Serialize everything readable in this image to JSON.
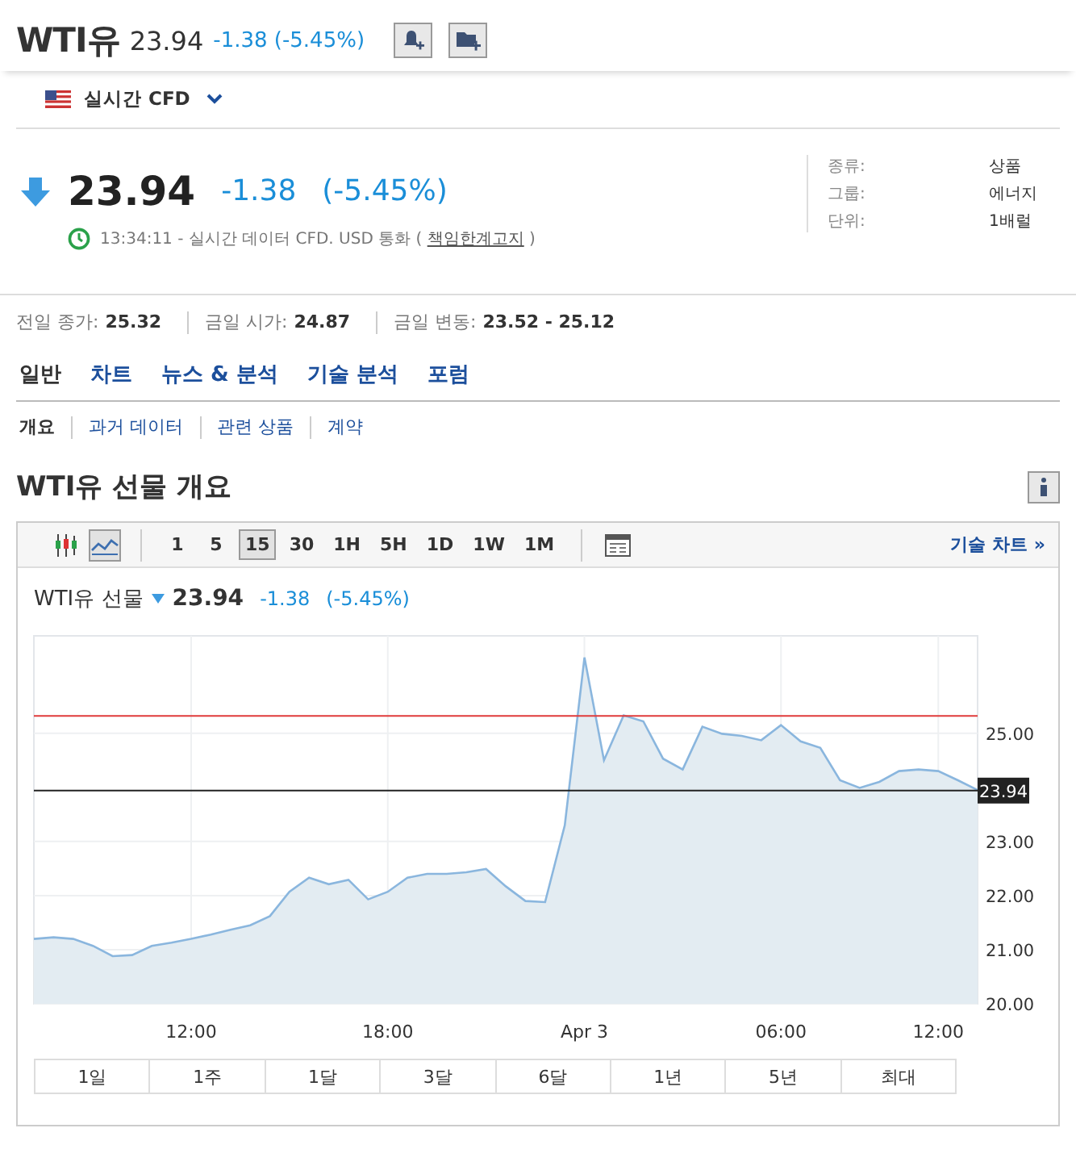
{
  "header": {
    "title": "WTI유",
    "price": "23.94",
    "change": "-1.38 (-5.45%)"
  },
  "market": {
    "label": "실시간 CFD"
  },
  "quote": {
    "down": true,
    "price": "23.94",
    "change": "-1.38",
    "change_pct": "(-5.45%)",
    "status": "13:34:11 - 실시간 데이터 CFD. USD 통화 (",
    "link": "책임한계고지",
    "status_end": ")"
  },
  "details": [
    {
      "label": "종류:",
      "value": "상품"
    },
    {
      "label": "그룹:",
      "value": "에너지"
    },
    {
      "label": "단위:",
      "value": "1배럴"
    }
  ],
  "stats": [
    {
      "label": "전일 종가:",
      "value": "25.32"
    },
    {
      "label": "금일 시가:",
      "value": "24.87"
    },
    {
      "label": "금일 변동:",
      "value": "23.52 - 25.12"
    }
  ],
  "tabs": [
    {
      "label": "일반",
      "selected": true
    },
    {
      "label": "차트",
      "selected": false
    },
    {
      "label": "뉴스 & 분석",
      "selected": false
    },
    {
      "label": "기술 분석",
      "selected": false
    },
    {
      "label": "포럼",
      "selected": false
    }
  ],
  "subtabs": [
    {
      "label": "개요",
      "selected": true
    },
    {
      "label": "과거 데이터",
      "selected": false
    },
    {
      "label": "관련 상품",
      "selected": false
    },
    {
      "label": "계약",
      "selected": false
    }
  ],
  "section_title": "WTI유 선물 개요",
  "chart_toolbar": {
    "chart_types": [
      {
        "kind": "candlestick",
        "selected": false
      },
      {
        "kind": "line",
        "selected": true
      }
    ],
    "intervals": [
      {
        "label": "1",
        "selected": false
      },
      {
        "label": "5",
        "selected": false
      },
      {
        "label": "15",
        "selected": true
      },
      {
        "label": "30",
        "selected": false
      },
      {
        "label": "1H",
        "selected": false
      },
      {
        "label": "5H",
        "selected": false
      },
      {
        "label": "1D",
        "selected": false
      },
      {
        "label": "1W",
        "selected": false
      },
      {
        "label": "1M",
        "selected": false
      }
    ],
    "link": "기술 차트 »"
  },
  "chart": {
    "legend": {
      "down": true,
      "price": "23.94",
      "change": "-1.38",
      "change_pct": "(-5.45%)"
    },
    "chart_data": {
      "type": "area",
      "categories": [
        null,
        null,
        null,
        null,
        null,
        null,
        null,
        null,
        "12:00",
        null,
        null,
        null,
        null,
        null,
        null,
        null,
        null,
        null,
        "18:00",
        null,
        null,
        null,
        null,
        null,
        null,
        null,
        null,
        null,
        "Apr 3",
        null,
        null,
        null,
        null,
        null,
        null,
        null,
        null,
        null,
        "06:00",
        null,
        null,
        null,
        null,
        null,
        null,
        null,
        "12:00",
        null,
        null
      ],
      "series": [
        {
          "name": "WTI유 선물",
          "color": "#8ab6de",
          "values": [
            21.2,
            21.23,
            21.2,
            21.07,
            20.88,
            20.9,
            21.07,
            21.13,
            21.2,
            21.28,
            21.37,
            21.45,
            21.62,
            22.07,
            22.33,
            22.21,
            22.29,
            21.93,
            22.07,
            22.33,
            22.4,
            22.4,
            22.43,
            22.49,
            22.17,
            21.9,
            21.88,
            23.3,
            26.4,
            24.5,
            25.33,
            25.22,
            24.53,
            24.33,
            25.12,
            24.99,
            24.95,
            24.87,
            25.15,
            24.85,
            24.73,
            24.13,
            23.99,
            24.1,
            24.3,
            24.33,
            24.3,
            24.13,
            23.95
          ]
        },
        {
          "type": "line",
          "color": "#e03b3b",
          "values": [
            25.32,
            25.32,
            25.32,
            25.32,
            25.32,
            25.32,
            25.32,
            25.32,
            25.32,
            25.32,
            25.32,
            25.32,
            25.32,
            25.32,
            25.32,
            25.32,
            25.32,
            25.32,
            25.32,
            25.32,
            25.32,
            25.32,
            25.32,
            25.32,
            25.32,
            25.32,
            25.32,
            25.32,
            25.32,
            25.32,
            25.32,
            25.32,
            25.32,
            25.32,
            25.32,
            25.32,
            25.32,
            25.32,
            25.32,
            25.32,
            25.32,
            25.32,
            25.32,
            25.32,
            25.32,
            25.32,
            25.32,
            25.32,
            25.32
          ]
        },
        {
          "type": "line",
          "color": "#222222",
          "values": [
            23.94,
            23.94,
            23.94,
            23.94,
            23.94,
            23.94,
            23.94,
            23.94,
            23.94,
            23.94,
            23.94,
            23.94,
            23.94,
            23.94,
            23.94,
            23.94,
            23.94,
            23.94,
            23.94,
            23.94,
            23.94,
            23.94,
            23.94,
            23.94,
            23.94,
            23.94,
            23.94,
            23.94,
            23.94,
            23.94,
            23.94,
            23.94,
            23.94,
            23.94,
            23.94,
            23.94,
            23.94,
            23.94,
            23.94,
            23.94,
            23.94,
            23.94,
            23.94,
            23.94,
            23.94,
            23.94,
            23.94,
            23.94,
            23.94
          ]
        }
      ],
      "ylim": [
        20,
        26.8
      ],
      "yticks": [
        {
          "value": 20,
          "label": "20.00"
        },
        {
          "value": 21,
          "label": "21.00"
        },
        {
          "value": 22,
          "label": "22.00"
        },
        {
          "value": 23,
          "label": "23.00"
        },
        {
          "value": 25,
          "label": "25.00"
        }
      ],
      "grid": true
    },
    "price_tag": "23.94"
  },
  "ranges": [
    "1일",
    "1주",
    "1달",
    "3달",
    "6달",
    "1년",
    "5년",
    "최대"
  ]
}
